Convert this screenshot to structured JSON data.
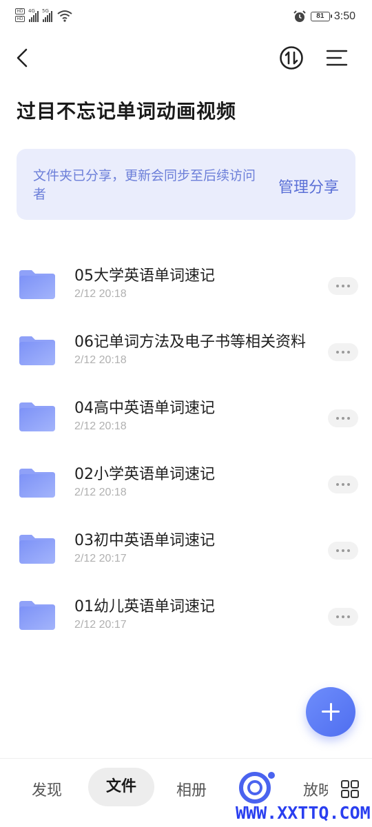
{
  "status_bar": {
    "hd_labels": [
      "HD",
      "HD"
    ],
    "signal_1_label": "4G",
    "signal_2_label": "5G",
    "battery": "81",
    "time": "3:50",
    "icons": [
      "signal-icon",
      "wifi-icon",
      "alarm-icon",
      "battery-icon"
    ]
  },
  "header": {
    "back_icon": "chevron-left-icon",
    "transfer_icon": "transfer-icon",
    "menu_icon": "menu-icon",
    "title": "过目不忘记单词动画视频"
  },
  "share_banner": {
    "text": "文件夹已分享，更新会同步至后续访问者",
    "manage_label": "管理分享"
  },
  "folders": [
    {
      "name": "05大学英语单词速记",
      "date": "2/12 20:18"
    },
    {
      "name": "06记单词方法及电子书等相关资料",
      "date": "2/12 20:18"
    },
    {
      "name": "04高中英语单词速记",
      "date": "2/12 20:18"
    },
    {
      "name": "02小学英语单词速记",
      "date": "2/12 20:18"
    },
    {
      "name": "03初中英语单词速记",
      "date": "2/12 20:17"
    },
    {
      "name": "01幼儿英语单词速记",
      "date": "2/12 20:17"
    }
  ],
  "fab": {
    "icon": "plus-icon"
  },
  "bottom_nav": {
    "tabs": [
      "发现",
      "文件",
      "相册"
    ],
    "active_tab": "文件",
    "partial_tab": "放映",
    "grid_icon": "grid-icon",
    "watermark": "WWW.XXTTQ.COM"
  },
  "colors": {
    "accent": "#4f6ef0",
    "banner_bg": "#eaedfc",
    "banner_text": "#6c7fd9",
    "folder": "#7b94f6"
  }
}
